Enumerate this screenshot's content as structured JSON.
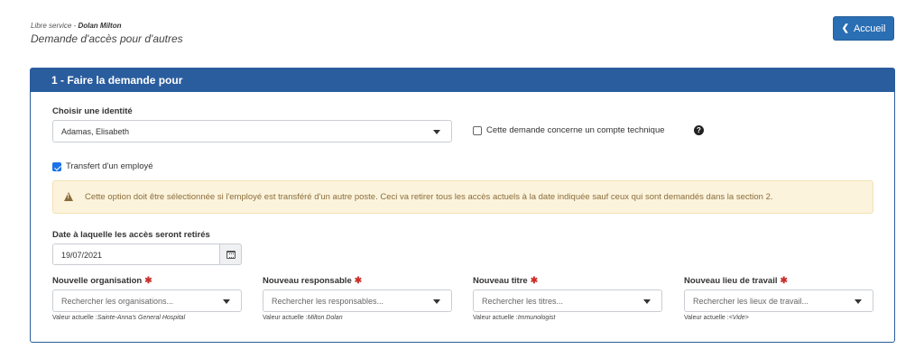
{
  "header": {
    "breadcrumb_prefix": "Libre service - ",
    "breadcrumb_user": "Dolan Milton",
    "title": "Demande d'accès pour d'autres",
    "home_button": "Accueil"
  },
  "section": {
    "title": "1 - Faire la demande pour",
    "identity_label": "Choisir une identité",
    "identity_value": "Adamas, Elisabeth",
    "tech_account_label": "Cette demande concerne un compte technique",
    "tech_account_checked": false,
    "transfer_label": "Transfert d'un employé",
    "transfer_checked": true,
    "warning_text": "Cette option doit être sélectionnée si l'employé est transféré d'un autre poste. Ceci va retirer tous les accès actuels à la date indiquée sauf ceux qui sont demandés dans la section 2.",
    "date_label": "Date à laquelle les accès seront retirés",
    "date_value": "19/07/2021",
    "required_mark": "✱",
    "current_prefix": "Valeur actuelle :",
    "fields": [
      {
        "label": "Nouvelle organisation",
        "placeholder": "Rechercher les organisations...",
        "current": "Sainte-Anna's General Hospital"
      },
      {
        "label": "Nouveau responsable",
        "placeholder": "Rechercher les responsables...",
        "current": "Milton Dolan"
      },
      {
        "label": "Nouveau titre",
        "placeholder": "Rechercher les titres...",
        "current": "Immunologist"
      },
      {
        "label": "Nouveau lieu de travail",
        "placeholder": "Rechercher les lieux de travail...",
        "current": "<Vide>"
      }
    ]
  },
  "colors": {
    "accent": "#2a5d9e",
    "button": "#2a6eb3",
    "warning_bg": "#fcf3dc",
    "warning_text": "#8a6d3b",
    "required": "#c9302c"
  },
  "icons": [
    "chevron-left-icon",
    "caret-down-icon",
    "question-circle-icon",
    "warning-triangle-icon",
    "calendar-icon",
    "checkbox-icon"
  ]
}
